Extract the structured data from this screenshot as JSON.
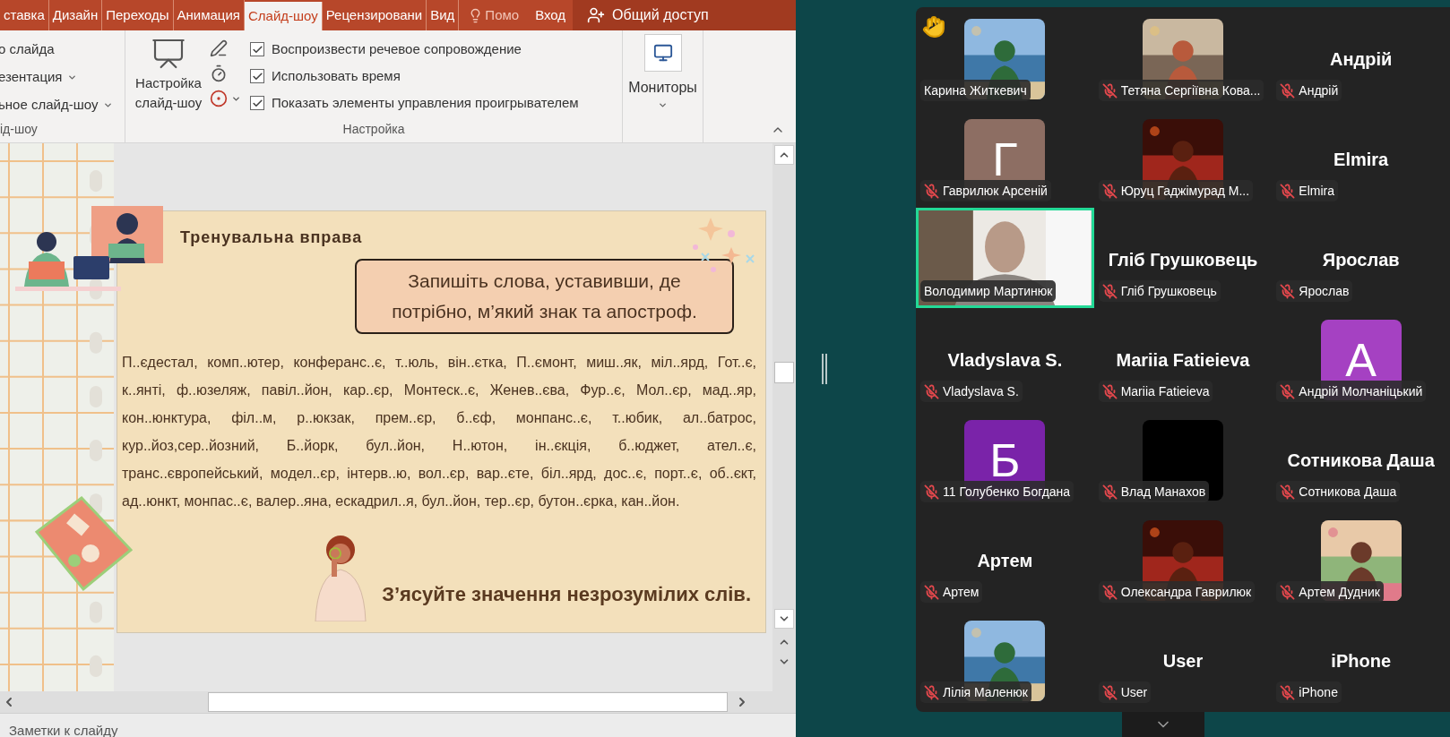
{
  "ribbon": {
    "tabs": [
      {
        "label": "ставка",
        "selected": false
      },
      {
        "label": "Дизайн",
        "selected": false
      },
      {
        "label": "Переходы",
        "selected": false
      },
      {
        "label": "Анимация",
        "selected": false
      },
      {
        "label": "Слайд-шоу",
        "selected": true
      },
      {
        "label": "Рецензировани",
        "selected": false
      },
      {
        "label": "Вид",
        "selected": false
      }
    ],
    "tell_me": "Помо",
    "sign_in": "Вход",
    "share": "Общий доступ",
    "start_group": {
      "items": [
        {
          "label": "о слайда",
          "dropdown": false
        },
        {
          "label": "езентация",
          "dropdown": true
        },
        {
          "label": "ьное слайд-шоу",
          "dropdown": true
        }
      ],
      "label": "ід-шоу"
    },
    "setup_group": {
      "setup_button": "Настройка слайд-шоу",
      "checkboxes": [
        {
          "label": "Воспроизвести речевое сопровождение",
          "checked": true
        },
        {
          "label": "Использовать время",
          "checked": true
        },
        {
          "label": "Показать элементы управления проигрывателем",
          "checked": true
        }
      ],
      "label": "Настройка"
    },
    "monitors_group": {
      "button": "Мониторы"
    }
  },
  "slide": {
    "title": "Тренувальна вправа",
    "task": "Запишіть слова, уставивши, де потрібно, м’який знак та апостроф.",
    "words": "П..єдестал, комп..ютер, конферанс..є, т..юль, він..єтка, П..ємонт, миш..як, міл..ярд, Гот..є, к..янті, ф..юзеляж, павіл..йон, кар..єр, Монтеск..є, Женев..єва, Фур..є, Мол..єр, мад..яр, кон..юнктура, філ..м, р..юкзак, прем..єр, б..єф, монпанс..є, т..юбик, ал..батрос, кур..йоз,сер..йозний, Б..йорк, бул..йон, Н..ютон, ін..єкція, б..юджет, ател..є, транс..європейський, модел..єр, інтерв..ю, вол..єр, вар..єте, біл..ярд, дос..є, порт..є, об..єкт, ад..юнкт, монпас..є, валер..яна, ескадрил..я, бул..йон, тер..єр, бутон..єрка, кан..йон.",
    "footer": "З’ясуйте значення незрозумілих слів."
  },
  "notes": {
    "label": "Заметки к слайду"
  },
  "meeting": {
    "tiles": [
      {
        "kind": "picture",
        "label": "Карина Житкевич",
        "muted": false,
        "hand_raised": true,
        "speaking": false
      },
      {
        "kind": "picture",
        "label": "Тетяна Сергіївна Кова...",
        "muted": true,
        "hand_raised": false,
        "speaking": false
      },
      {
        "kind": "name",
        "display_name": "Андрій",
        "label": "Андрій",
        "muted": true,
        "hand_raised": false,
        "speaking": false
      },
      {
        "kind": "letter",
        "letter": "Г",
        "color": "#8d6e63",
        "label": "Гаврилюк Арсеній",
        "muted": true,
        "hand_raised": false,
        "speaking": false
      },
      {
        "kind": "picture",
        "label": "Юруц Гаджімурад М...",
        "muted": true,
        "hand_raised": false,
        "speaking": false
      },
      {
        "kind": "name",
        "display_name": "Elmira",
        "label": "Elmira",
        "muted": true,
        "hand_raised": false,
        "speaking": false
      },
      {
        "kind": "video",
        "label": "Володимир Мартинюк",
        "muted": false,
        "hand_raised": false,
        "speaking": true
      },
      {
        "kind": "name",
        "display_name": "Гліб Грушковець",
        "label": "Гліб Грушковець",
        "muted": true,
        "hand_raised": false,
        "speaking": false
      },
      {
        "kind": "name",
        "display_name": "Ярослав",
        "label": "Ярослав",
        "muted": true,
        "hand_raised": false,
        "speaking": false
      },
      {
        "kind": "name",
        "display_name": "Vladyslava S.",
        "label": "Vladyslava S.",
        "muted": true,
        "hand_raised": false,
        "speaking": false
      },
      {
        "kind": "name",
        "display_name": "Mariia Fatieieva",
        "label": "Mariia Fatieieva",
        "muted": true,
        "hand_raised": false,
        "speaking": false
      },
      {
        "kind": "letter",
        "letter": "А",
        "color": "#a541c2",
        "label": "Андрій Молчаніцький",
        "muted": true,
        "hand_raised": false,
        "speaking": false
      },
      {
        "kind": "letter",
        "letter": "Б",
        "color": "#7a23a9",
        "label": "11 Голубенко Богдана",
        "muted": true,
        "hand_raised": false,
        "speaking": false
      },
      {
        "kind": "blank",
        "label": "Влад Манахов",
        "muted": true,
        "hand_raised": false,
        "speaking": false
      },
      {
        "kind": "name",
        "display_name": "Сотникова Даша",
        "label": "Сотникова Даша",
        "muted": true,
        "hand_raised": false,
        "speaking": false
      },
      {
        "kind": "name",
        "display_name": "Артем",
        "label": "Артем",
        "muted": true,
        "hand_raised": false,
        "speaking": false
      },
      {
        "kind": "picture",
        "label": "Олександра Гаврилюк",
        "muted": true,
        "hand_raised": false,
        "speaking": false
      },
      {
        "kind": "picture",
        "label": "Артем Дудник",
        "muted": true,
        "hand_raised": false,
        "speaking": false
      },
      {
        "kind": "picture",
        "label": "Лілія Маленюк",
        "muted": true,
        "hand_raised": false,
        "speaking": false
      },
      {
        "kind": "name",
        "display_name": "User",
        "label": "User",
        "muted": true,
        "hand_raised": false,
        "speaking": false
      },
      {
        "kind": "name",
        "display_name": "iPhone",
        "label": "iPhone",
        "muted": true,
        "hand_raised": false,
        "speaking": false
      }
    ]
  }
}
